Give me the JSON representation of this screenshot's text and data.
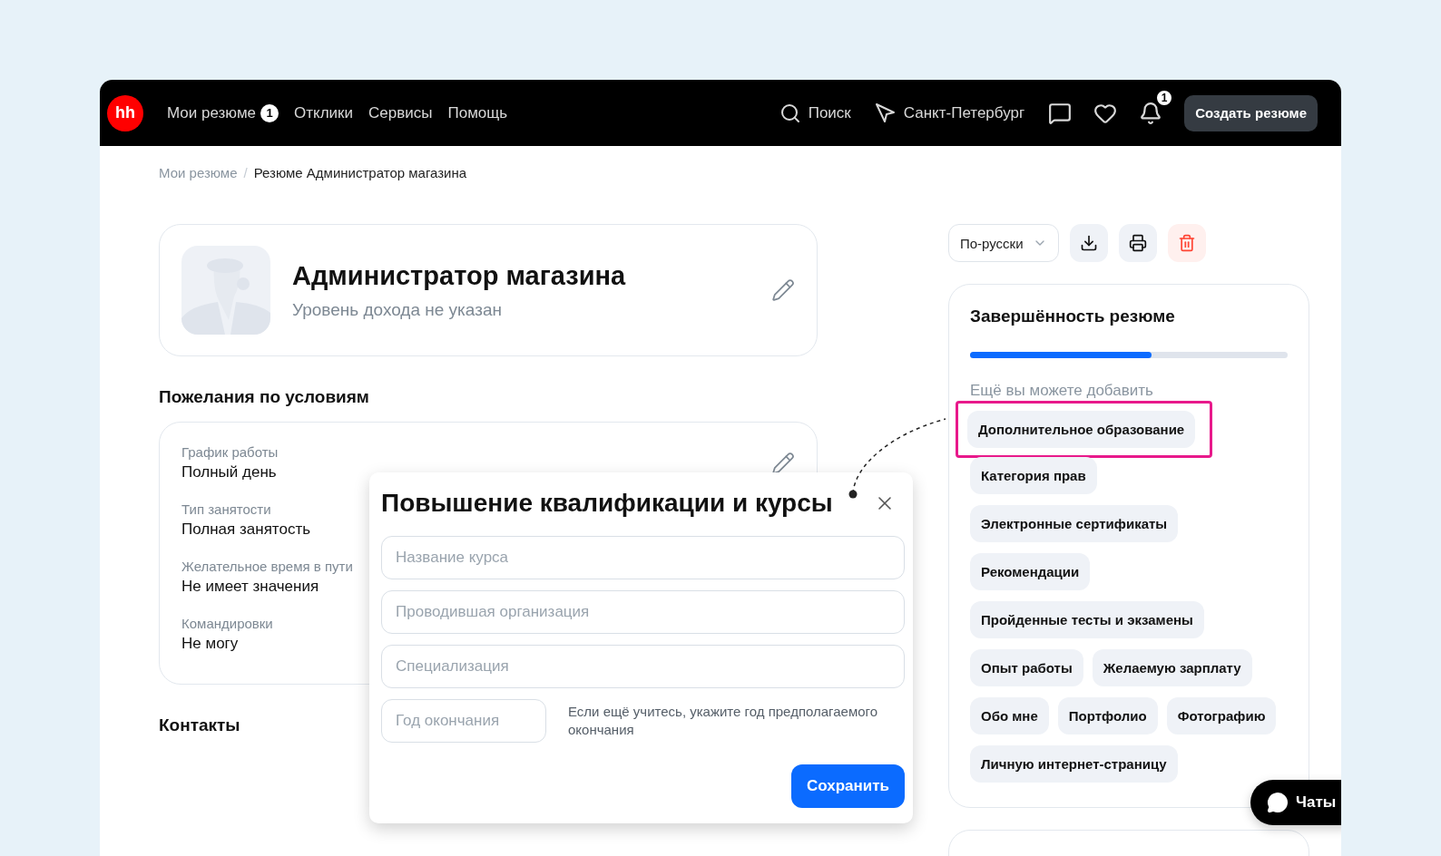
{
  "header": {
    "logo": "hh",
    "nav": [
      {
        "label": "Мои резюме",
        "badge": "1"
      },
      {
        "label": "Отклики"
      },
      {
        "label": "Сервисы"
      },
      {
        "label": "Помощь"
      }
    ],
    "search": "Поиск",
    "city": "Санкт-Петербург",
    "notifications_badge": "1",
    "create_button": "Создать резюме"
  },
  "breadcrumbs": [
    {
      "label": "Мои резюме",
      "current": false
    },
    {
      "label": "Резюме Администратор магазина",
      "current": true
    }
  ],
  "breadcrumb_separator": "/",
  "resume_card": {
    "title": "Администратор магазина",
    "salary": "Уровень дохода не указан"
  },
  "conditions": {
    "heading": "Пожелания по условиям",
    "items": [
      {
        "label": "График работы",
        "value": "Полный день"
      },
      {
        "label": "Тип занятости",
        "value": "Полная занятость"
      },
      {
        "label": "Желательное время в пути",
        "value": "Не имеет значения"
      },
      {
        "label": "Командировки",
        "value": "Не могу"
      }
    ]
  },
  "contacts_heading": "Контакты",
  "toolbar": {
    "language": "По-русски"
  },
  "completeness": {
    "title": "Завершённость резюме",
    "level": 0.57,
    "hint": "Ещё вы можете добавить",
    "chips": [
      {
        "label": "Дополнительное образование",
        "highlighted": true
      },
      {
        "label": "Категория прав",
        "highlighted": false
      },
      {
        "label": "Электронные сертификаты",
        "highlighted": false
      },
      {
        "label": "Рекомендации",
        "highlighted": false
      },
      {
        "label": "Пройденные тесты и экзамены",
        "highlighted": false
      },
      {
        "label": "Опыт работы",
        "highlighted": false
      },
      {
        "label": "Желаемую зарплату",
        "highlighted": false
      },
      {
        "label": "Обо мне",
        "highlighted": false
      },
      {
        "label": "Портфолио",
        "highlighted": false
      },
      {
        "label": "Фотографию",
        "highlighted": false
      },
      {
        "label": "Личную интернет-страницу",
        "highlighted": false
      }
    ]
  },
  "modal": {
    "title": "Повышение квалификации и курсы",
    "fields": [
      {
        "placeholder": "Название курса"
      },
      {
        "placeholder": "Проводившая организация"
      },
      {
        "placeholder": "Специализация"
      }
    ],
    "year_field": {
      "placeholder": "Год окончания"
    },
    "year_hint": "Если ещё учитесь, укажите год предполагаемого окончания",
    "save_button": "Сохранить"
  },
  "chats_button": "Чаты"
}
